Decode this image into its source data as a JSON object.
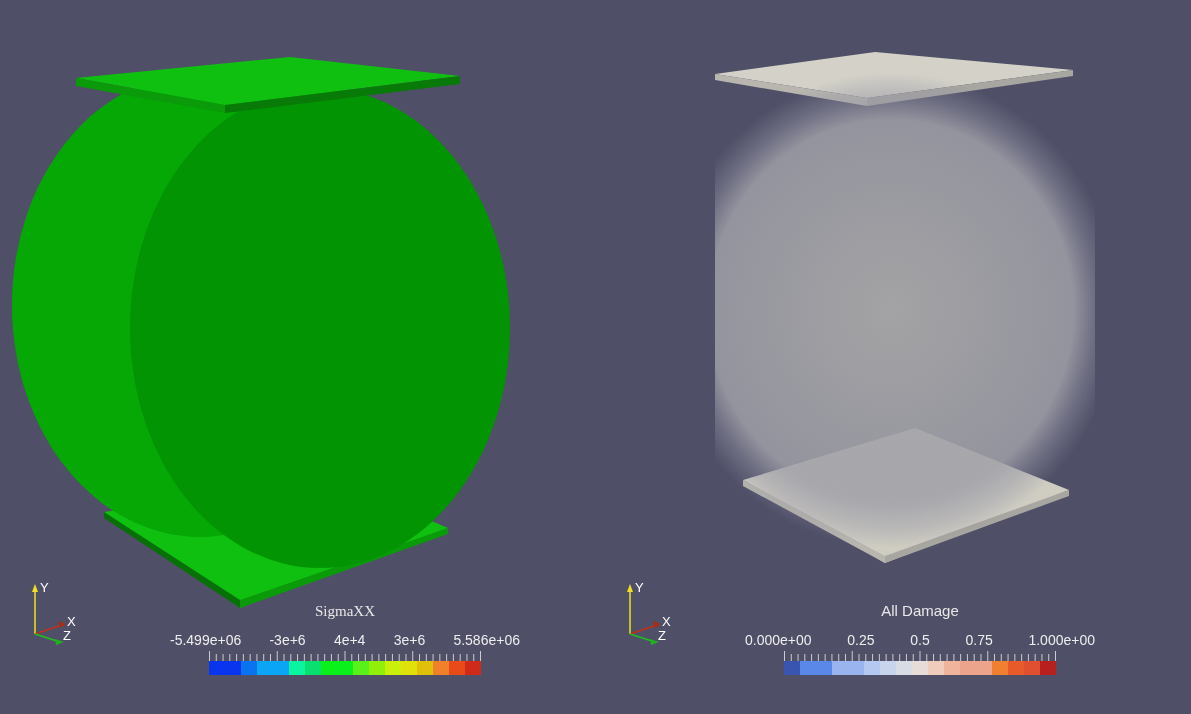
{
  "views": [
    {
      "kind": "solid",
      "axes": [
        "Y",
        "X",
        "Z"
      ],
      "legend": {
        "title": "SigmaXX",
        "kind": "rainbow",
        "ticks": [
          "-5.499e+06",
          "-3e+6",
          "4e+4",
          "3e+6",
          "5.586e+06"
        ]
      }
    },
    {
      "kind": "volume",
      "axes": [
        "Y",
        "X",
        "Z"
      ],
      "legend": {
        "title": "All Damage",
        "kind": "coolwarm",
        "ticks": [
          "0.000e+00",
          "0.25",
          "0.5",
          "0.75",
          "1.000e+00"
        ]
      }
    }
  ]
}
